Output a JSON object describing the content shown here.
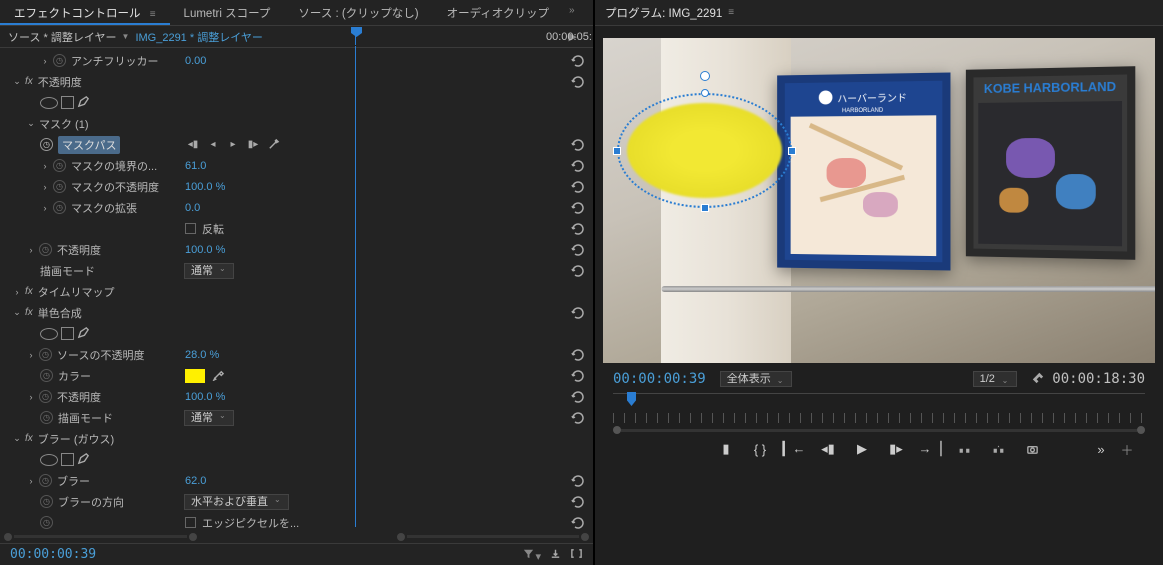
{
  "tabs": {
    "effect_controls": "エフェクトコントロール",
    "lumetri_scopes": "Lumetri スコープ",
    "source": "ソース : (クリップなし)",
    "audio_clip": "オーディオクリップ"
  },
  "source_bar": {
    "label": "ソース * 調整レイヤー",
    "clip": "IMG_2291 * 調整レイヤー",
    "end_time": "00:00:05:"
  },
  "effects": {
    "anti_flicker": {
      "name": "アンチフリッカー",
      "value": "0.00"
    },
    "opacity_fx": {
      "name": "不透明度"
    },
    "mask1": {
      "name": "マスク (1)"
    },
    "mask_path": {
      "name": "マスクパス"
    },
    "mask_feather": {
      "name": "マスクの境界の...",
      "value": "61.0"
    },
    "mask_opacity": {
      "name": "マスクの不透明度",
      "value": "100.0 %"
    },
    "mask_expansion": {
      "name": "マスクの拡張",
      "value": "0.0"
    },
    "invert": {
      "label": "反転"
    },
    "opacity": {
      "name": "不透明度",
      "value": "100.0 %"
    },
    "blend_mode": {
      "name": "描画モード",
      "value": "通常"
    },
    "time_remap": {
      "name": "タイムリマップ"
    },
    "solid_composite": {
      "name": "単色合成"
    },
    "source_opacity": {
      "name": "ソースの不透明度",
      "value": "28.0 %"
    },
    "color": {
      "name": "カラー"
    },
    "sc_opacity": {
      "name": "不透明度",
      "value": "100.0 %"
    },
    "sc_blend": {
      "name": "描画モード",
      "value": "通常"
    },
    "gaussian_blur": {
      "name": "ブラー (ガウス)"
    },
    "blurriness": {
      "name": "ブラー",
      "value": "62.0"
    },
    "blur_dir": {
      "name": "ブラーの方向",
      "value": "水平および垂直"
    },
    "repeat_edge": {
      "label": "エッジピクセルを..."
    }
  },
  "left_timecode": "00:00:00:39",
  "program": {
    "title": "プログラム: IMG_2291",
    "harborland_jp": "ハーバーランド",
    "harborland_sub": "HARBORLAND",
    "kobe_title": "KOBE HARBORLAND"
  },
  "prog_controls": {
    "time_left": "00:00:00:39",
    "fit": "全体表示",
    "resolution": "1/2",
    "time_right": "00:00:18:30"
  },
  "colors": {
    "solid": "#fff000"
  }
}
